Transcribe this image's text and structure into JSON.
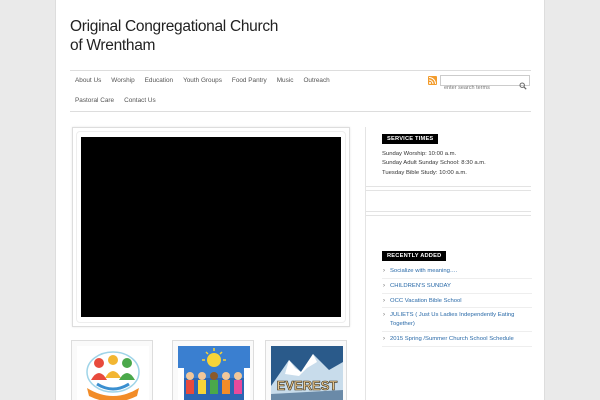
{
  "site": {
    "title": "Original Congregational Church of Wrentham"
  },
  "nav": {
    "row1": [
      "About Us",
      "Worship",
      "Education",
      "Youth Groups",
      "Food Pantry",
      "Music",
      "Outreach"
    ],
    "row2": [
      "Pastoral Care",
      "Contact Us"
    ]
  },
  "search": {
    "placeholder": "enter search terms"
  },
  "service_times": {
    "title": "SERVICE TIMES",
    "lines": [
      "Sunday Worship: 10:00 a.m.",
      "Sunday Adult Sunday School: 8:30 a.m.",
      "Tuesday Bible Study: 10:00 a.m."
    ]
  },
  "recently_added": {
    "title": "RECENTLY ADDED",
    "items": [
      "Socialize with meaning….",
      "CHILDREN'S SUNDAY",
      "OCC Vacation Bible School",
      "JULIETS ( Just Us Ladies Independently Eating Together)",
      "2015 Spring /Summer Church School Schedule"
    ]
  },
  "thumbs": {
    "third_text": "EVEREST"
  },
  "colors": {
    "link": "#2a6aa8",
    "rss": "#f39c2c",
    "widget_title_bg": "#000000"
  },
  "icons": {
    "rss": "rss-icon",
    "search": "search-icon"
  }
}
